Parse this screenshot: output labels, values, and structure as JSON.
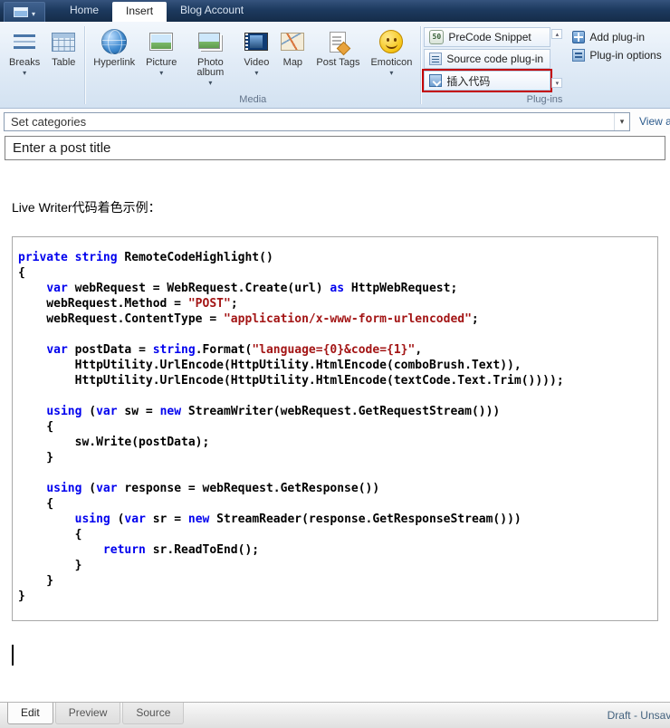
{
  "titlebar": {
    "tabs": [
      {
        "label": "Home"
      },
      {
        "label": "Insert"
      },
      {
        "label": "Blog Account"
      }
    ]
  },
  "ribbon": {
    "break_group": {
      "breaks": "Breaks",
      "table": "Table"
    },
    "media": {
      "label": "Media",
      "hyperlink": "Hyperlink",
      "picture": "Picture",
      "photo_album": "Photo album",
      "video": "Video",
      "map": "Map",
      "post_tags": "Post Tags",
      "emoticon": "Emoticon"
    },
    "plugins": {
      "label": "Plug-ins",
      "precode": "PreCode Snippet",
      "source_code": "Source code plug-in",
      "insert_code": "插入代码",
      "add_plugin": "Add plug-in",
      "plugin_options": "Plug-in options",
      "highlight_color": "#c40000"
    }
  },
  "categories": {
    "value": "Set categories",
    "view_link": "View a"
  },
  "post": {
    "title_placeholder": "Enter a post title",
    "intro": "Live Writer代码着色示例："
  },
  "code": {
    "keyword_color": "#0000ee",
    "string_color": "#a31515",
    "lines": [
      [
        [
          "k",
          "private"
        ],
        [
          "p",
          " "
        ],
        [
          "k",
          "string"
        ],
        [
          "p",
          " RemoteCodeHighlight()"
        ]
      ],
      [
        [
          "p",
          "{"
        ]
      ],
      [
        [
          "p",
          "    "
        ],
        [
          "k",
          "var"
        ],
        [
          "p",
          " webRequest = WebRequest.Create(url) "
        ],
        [
          "k",
          "as"
        ],
        [
          "p",
          " HttpWebRequest;"
        ]
      ],
      [
        [
          "p",
          "    webRequest.Method = "
        ],
        [
          "s",
          "\"POST\""
        ],
        [
          "p",
          ";"
        ]
      ],
      [
        [
          "p",
          "    webRequest.ContentType = "
        ],
        [
          "s",
          "\"application/x-www-form-urlencoded\""
        ],
        [
          "p",
          ";"
        ]
      ],
      [],
      [
        [
          "p",
          "    "
        ],
        [
          "k",
          "var"
        ],
        [
          "p",
          " postData = "
        ],
        [
          "k",
          "string"
        ],
        [
          "p",
          ".Format("
        ],
        [
          "s",
          "\"language={0}&code={1}\""
        ],
        [
          "p",
          ","
        ]
      ],
      [
        [
          "p",
          "        HttpUtility.UrlEncode(HttpUtility.HtmlEncode(comboBrush.Text)),"
        ]
      ],
      [
        [
          "p",
          "        HttpUtility.UrlEncode(HttpUtility.HtmlEncode(textCode.Text.Trim())));"
        ]
      ],
      [],
      [
        [
          "p",
          "    "
        ],
        [
          "k",
          "using"
        ],
        [
          "p",
          " ("
        ],
        [
          "k",
          "var"
        ],
        [
          "p",
          " sw = "
        ],
        [
          "k",
          "new"
        ],
        [
          "p",
          " StreamWriter(webRequest.GetRequestStream()))"
        ]
      ],
      [
        [
          "p",
          "    {"
        ]
      ],
      [
        [
          "p",
          "        sw.Write(postData);"
        ]
      ],
      [
        [
          "p",
          "    }"
        ]
      ],
      [],
      [
        [
          "p",
          "    "
        ],
        [
          "k",
          "using"
        ],
        [
          "p",
          " ("
        ],
        [
          "k",
          "var"
        ],
        [
          "p",
          " response = webRequest.GetResponse())"
        ]
      ],
      [
        [
          "p",
          "    {"
        ]
      ],
      [
        [
          "p",
          "        "
        ],
        [
          "k",
          "using"
        ],
        [
          "p",
          " ("
        ],
        [
          "k",
          "var"
        ],
        [
          "p",
          " sr = "
        ],
        [
          "k",
          "new"
        ],
        [
          "p",
          " StreamReader(response.GetResponseStream()))"
        ]
      ],
      [
        [
          "p",
          "        {"
        ]
      ],
      [
        [
          "p",
          "            "
        ],
        [
          "k",
          "return"
        ],
        [
          "p",
          " sr.ReadToEnd();"
        ]
      ],
      [
        [
          "p",
          "        }"
        ]
      ],
      [
        [
          "p",
          "    }"
        ]
      ],
      [
        [
          "p",
          "}"
        ]
      ]
    ]
  },
  "statusbar": {
    "edit": "Edit",
    "preview": "Preview",
    "source": "Source",
    "status": "Draft - Unsave"
  }
}
